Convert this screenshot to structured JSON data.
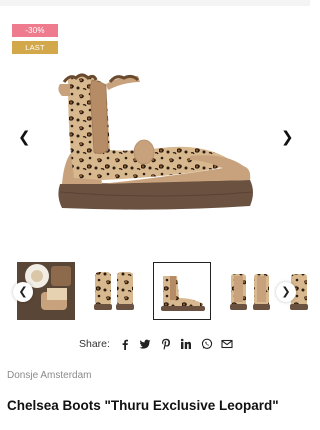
{
  "badges": {
    "discount": "-30%",
    "stock": "LAST ONE"
  },
  "gallery": {
    "prev_icon": "chevron-left-icon",
    "next_icon": "chevron-right-icon",
    "thumbnail_count": 5,
    "selected_index": 2
  },
  "share": {
    "label": "Share:",
    "icons": [
      "facebook-icon",
      "twitter-icon",
      "pinterest-icon",
      "linkedin-icon",
      "whatsapp-icon",
      "email-icon"
    ]
  },
  "product": {
    "brand": "Donsje Amsterdam",
    "name": "Chelsea Boots \"Thuru Exclusive Leopard\""
  },
  "colors": {
    "discount_badge": "#ee7c8e",
    "last_one_badge": "#d3a84a",
    "boot_tan": "#c8a27c",
    "sole_brown": "#6b5140"
  }
}
